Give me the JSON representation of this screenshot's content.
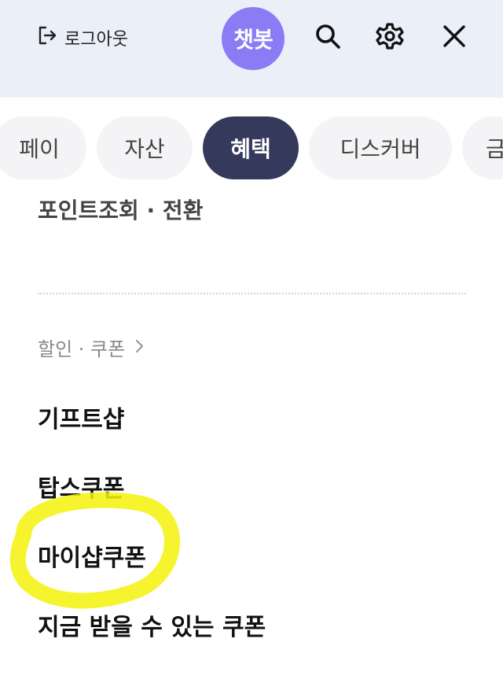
{
  "header": {
    "logout_label": "로그아웃",
    "chatbot_label": "챗봇",
    "icons": [
      "logout-icon",
      "search-icon",
      "gear-icon",
      "close-icon"
    ]
  },
  "tabs": [
    {
      "label": "페이",
      "active": false
    },
    {
      "label": "자산",
      "active": false
    },
    {
      "label": "혜택",
      "active": true
    },
    {
      "label": "디스커버",
      "active": false
    },
    {
      "label": "금",
      "active": false
    }
  ],
  "content": {
    "top_item": "포인트조회 · 전환",
    "section_title": "할인 · 쿠폰",
    "items": [
      "기프트샵",
      "탑스쿠폰",
      "마이샵쿠폰",
      "지금 받을 수 있는 쿠폰"
    ]
  },
  "colors": {
    "header_bg": "#eaeff8",
    "chatbot_bg": "#8b7cf6",
    "active_tab_bg": "#353a5c",
    "tab_bg": "#f4f4f6",
    "highlight": "#f5f20a"
  }
}
